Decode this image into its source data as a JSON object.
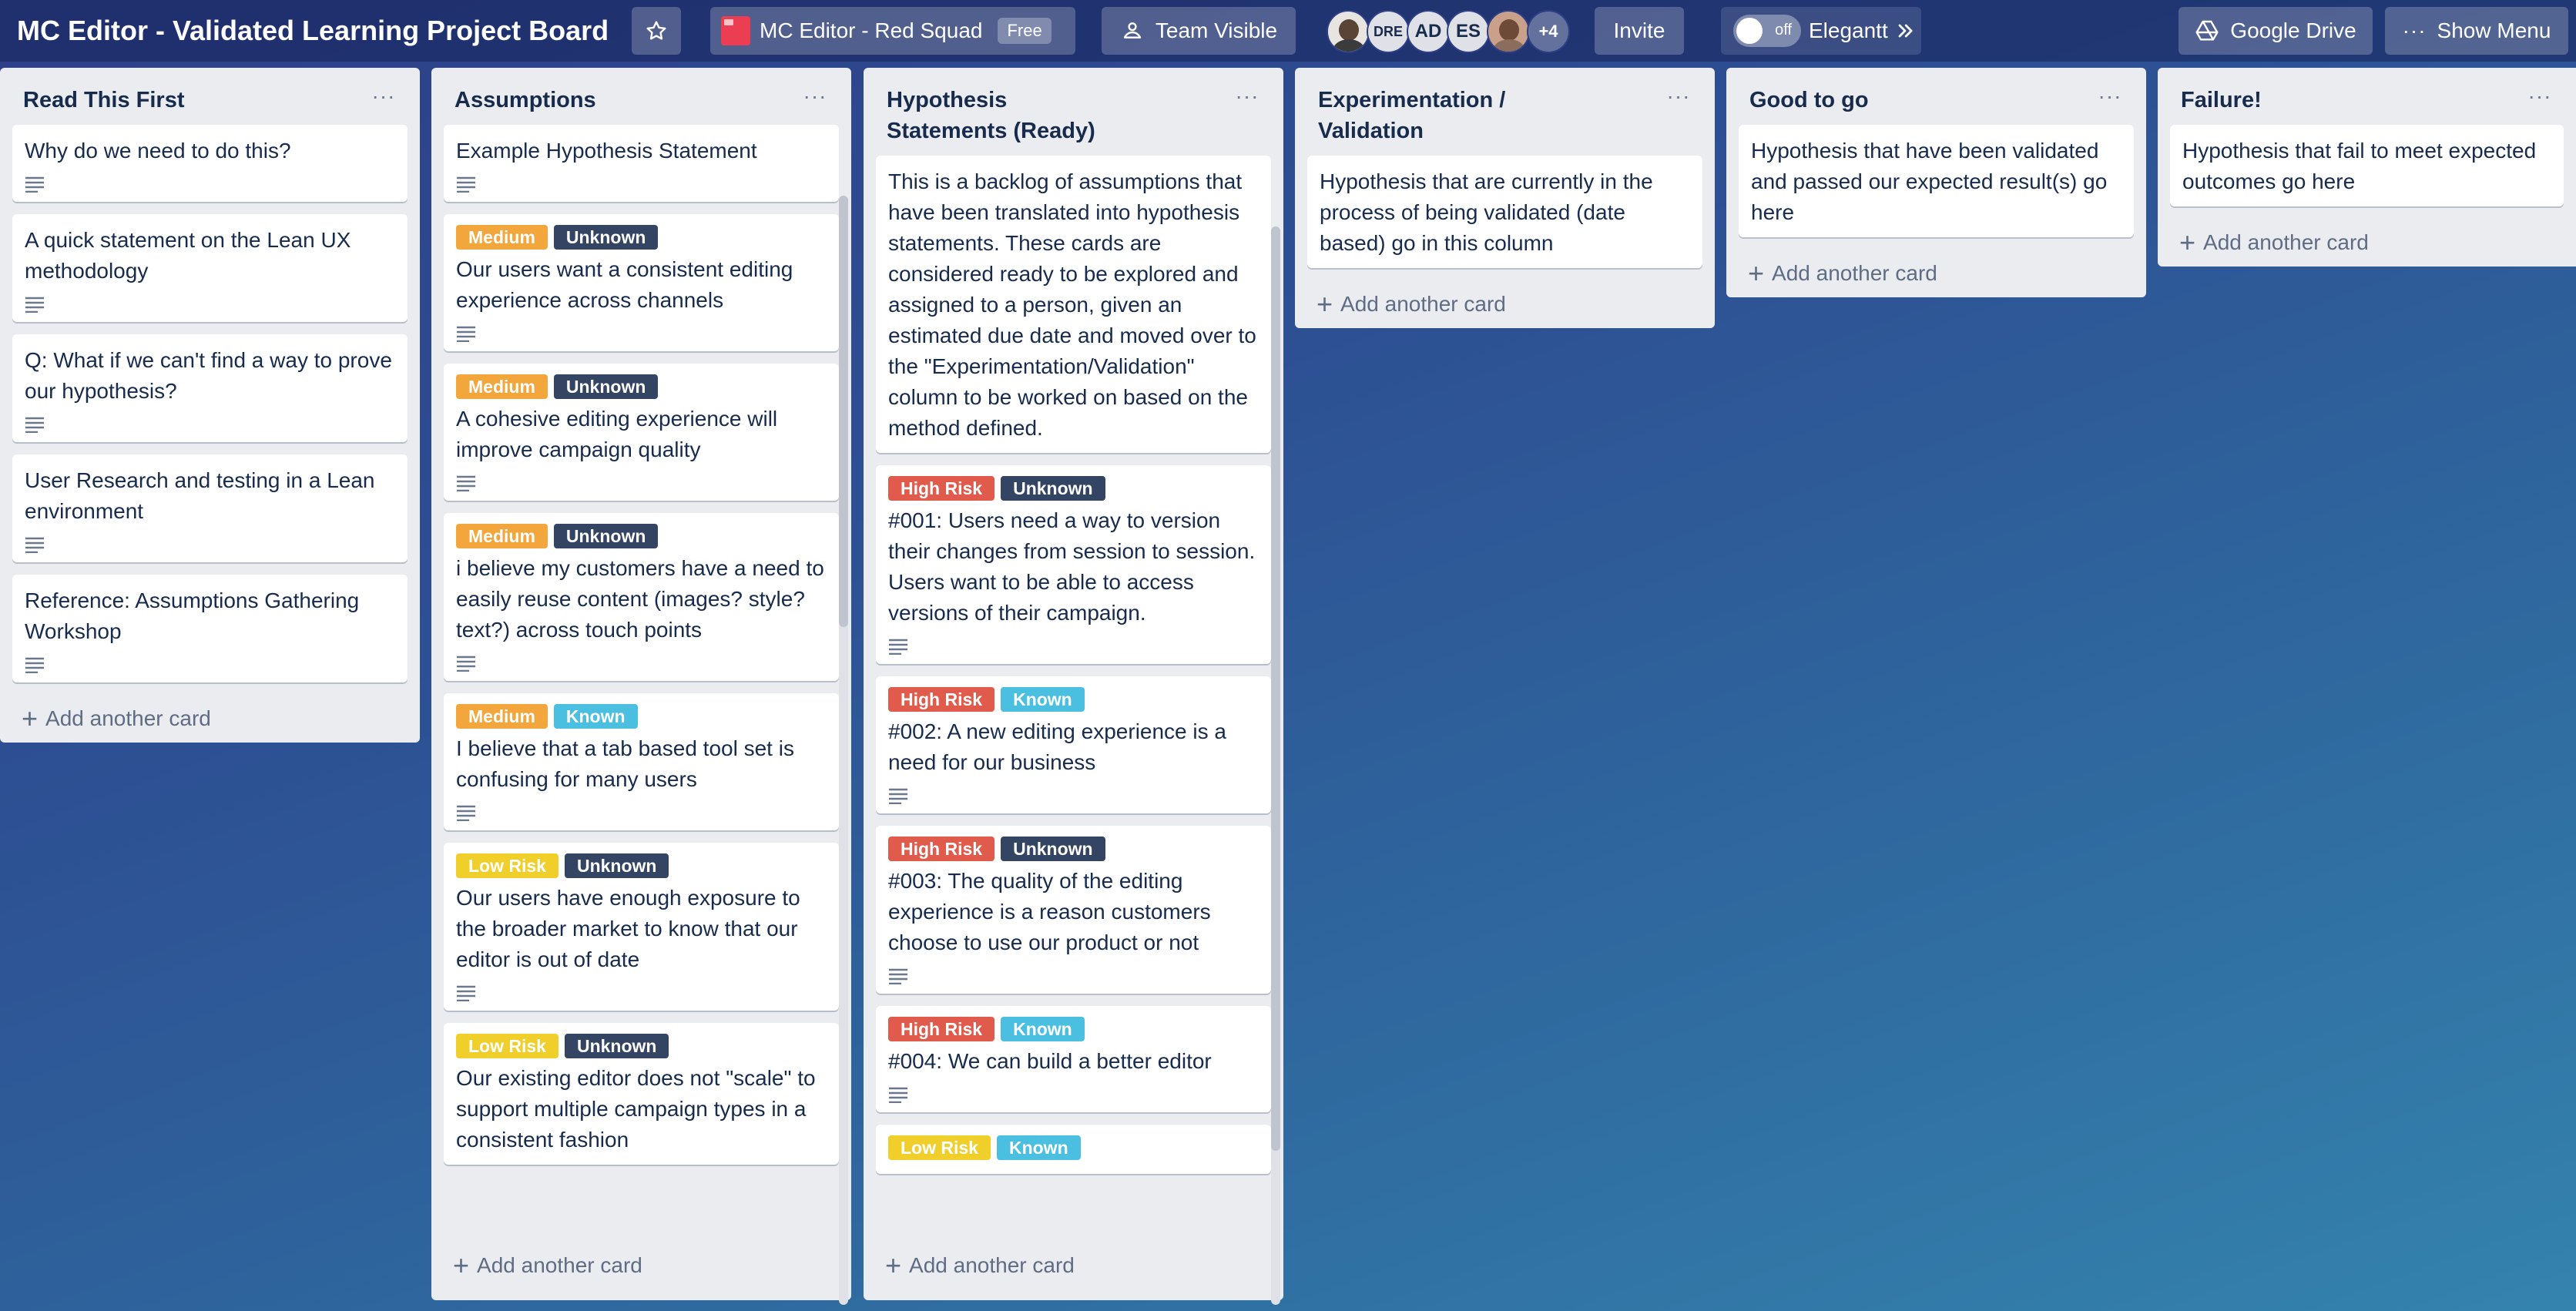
{
  "header": {
    "board_title": "MC Editor - Validated Learning Project Board",
    "team_name": "MC Editor - Red Squad",
    "team_badge": "Free",
    "visibility": "Team Visible",
    "avatars": [
      "DRE",
      "AD",
      "ES"
    ],
    "avatars_more": "+4",
    "invite_label": "Invite",
    "toggle_state": "off",
    "toggle_label": "Elegantt",
    "gdrive_label": "Google Drive",
    "menu_label": "Show Menu"
  },
  "colors": {
    "medium": "#f2a63b",
    "unknown": "#344563",
    "known": "#4bbfe0",
    "low_risk": "#f0cf2a",
    "high_risk": "#e05b4b"
  },
  "add_card_label": "Add another card",
  "lists": [
    {
      "title": "Read This First",
      "cards": [
        {
          "text": "Why do we need to do this?"
        },
        {
          "text": "A quick statement on the Lean UX methodology"
        },
        {
          "text": "Q: What if we can't find a way to prove our hypothesis?"
        },
        {
          "text": "User Research and testing in a Lean environment"
        },
        {
          "text": "Reference: Assumptions Gathering Workshop"
        }
      ]
    },
    {
      "title": "Assumptions",
      "cards": [
        {
          "text": "Example Hypothesis Statement",
          "labels": []
        },
        {
          "text": "Our users want a consistent editing experience across channels",
          "labels": [
            "Medium",
            "Unknown"
          ]
        },
        {
          "text": "A cohesive editing experience will improve campaign quality",
          "labels": [
            "Medium",
            "Unknown"
          ]
        },
        {
          "text": "i believe my customers have a need to easily reuse content (images? style? text?) across touch points",
          "labels": [
            "Medium",
            "Unknown"
          ]
        },
        {
          "text": "I believe that a tab based tool set is confusing for many users",
          "labels": [
            "Medium",
            "Known"
          ]
        },
        {
          "text": "Our users have enough exposure to the broader market to know that our editor is out of date",
          "labels": [
            "Low Risk",
            "Unknown"
          ]
        },
        {
          "text": "Our existing editor does not \"scale\" to support multiple campaign types in a consistent fashion",
          "labels": [
            "Low Risk",
            "Unknown"
          ]
        }
      ]
    },
    {
      "title": "Hypothesis Statements (Ready)",
      "cards": [
        {
          "text": "This is a backlog of assumptions that have been translated into hypothesis statements. These cards are considered ready to be explored and assigned to a person, given an estimated due date and moved over to the \"Experimentation/Validation\" column to be worked on based on the method defined.",
          "labels": []
        },
        {
          "text": "#001: Users need a way to version their changes from session to session. Users want to be able to access versions of their campaign.",
          "labels": [
            "High Risk",
            "Unknown"
          ]
        },
        {
          "text": "#002: A new editing experience is a need for our business",
          "labels": [
            "High Risk",
            "Known"
          ]
        },
        {
          "text": "#003: The quality of the editing experience is a reason customers choose to use our product or not",
          "labels": [
            "High Risk",
            "Unknown"
          ]
        },
        {
          "text": "#004: We can build a better editor",
          "labels": [
            "High Risk",
            "Known"
          ]
        },
        {
          "text": "",
          "labels": [
            "Low Risk",
            "Known"
          ]
        }
      ]
    },
    {
      "title": "Experimentation / Validation",
      "cards": [
        {
          "text": "Hypothesis that are currently in the process of being validated (date based) go in this column"
        }
      ]
    },
    {
      "title": "Good to go",
      "cards": [
        {
          "text": "Hypothesis that have been validated and passed our expected result(s) go here"
        }
      ]
    },
    {
      "title": "Failure!",
      "cards": [
        {
          "text": "Hypothesis that fail to meet expected outcomes go here"
        }
      ]
    }
  ]
}
